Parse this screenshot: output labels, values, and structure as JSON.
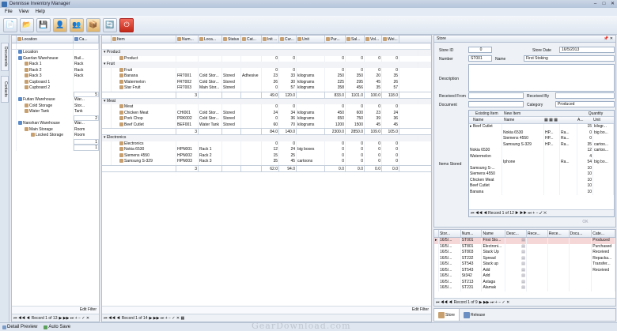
{
  "window": {
    "title": "Dennisse Inventory Manager",
    "minimize": "–",
    "maximize": "□",
    "close": "✕"
  },
  "menu": [
    "File",
    "View",
    "Help"
  ],
  "toolbar": {
    "icons": [
      "new-icon",
      "open-icon",
      "save-icon",
      "add-user-icon",
      "users-icon",
      "package-icon",
      "transfer-icon",
      "power-icon"
    ]
  },
  "sidetabs": {
    "documents": "Documents",
    "contacts": "Contacts"
  },
  "location_panel": {
    "headers": [
      "Location",
      "Ca..."
    ],
    "rows": [
      {
        "name": "Location",
        "cat": "",
        "level": 0
      },
      {
        "name": "Guerlan Warehouse",
        "cat": "Buil...",
        "level": 0
      },
      {
        "name": "Rack 1",
        "cat": "Rack",
        "level": 1
      },
      {
        "name": "Rack 2",
        "cat": "Rack",
        "level": 1
      },
      {
        "name": "Rack 3",
        "cat": "Rack",
        "level": 1
      },
      {
        "name": "Cupboard 1",
        "cat": "",
        "level": 1
      },
      {
        "name": "Cupboard 2",
        "cat": "",
        "level": 1
      },
      {
        "name": "",
        "cat": "5",
        "level": 1,
        "sum": true
      },
      {
        "name": "Futian Warehouse",
        "cat": "War...",
        "level": 0
      },
      {
        "name": "Cold Storage",
        "cat": "Stor...",
        "level": 1
      },
      {
        "name": "Water Tank",
        "cat": "Tank",
        "level": 1
      },
      {
        "name": "",
        "cat": "2",
        "level": 1,
        "sum": true
      },
      {
        "name": "Nanshan Warehouse",
        "cat": "War...",
        "level": 0
      },
      {
        "name": "Main Storage",
        "cat": "Room",
        "level": 1
      },
      {
        "name": "Locked Storage",
        "cat": "Room",
        "level": 2
      },
      {
        "name": "",
        "cat": "1",
        "level": 2,
        "sum": true
      },
      {
        "name": "",
        "cat": "1",
        "level": 1,
        "sum": true
      }
    ],
    "edit_filter": "Edit Filter",
    "pager": "Record 1 of 13"
  },
  "item_panel": {
    "headers": [
      "Item",
      "Num...",
      "Loca...",
      "Status",
      "Cat...",
      "Init ...",
      "Cur...",
      "Unit",
      "Pur...",
      "Sal...",
      "Vol...",
      "Wei..."
    ],
    "groups": [
      {
        "title": "Product",
        "items": [
          {
            "name": "Product",
            "num": "",
            "loc": "",
            "status": "",
            "cat": "",
            "init": "0",
            "cur": "0",
            "unit": "",
            "pur": "0",
            "sal": "0",
            "vol": "0",
            "wei": "0"
          }
        ]
      },
      {
        "title": "Fruit",
        "items": [
          {
            "name": "Fruit",
            "num": "",
            "loc": "",
            "status": "",
            "cat": "",
            "init": "0",
            "cur": "0",
            "unit": "",
            "pur": "0",
            "sal": "0",
            "vol": "0",
            "wei": "0"
          },
          {
            "name": "Banana",
            "num": "FRT001",
            "loc": "Cold Stor...",
            "status": "Stored",
            "cat": "Adhesive",
            "init": "23",
            "cur": "33",
            "unit": "kilograms",
            "pur": "250",
            "sal": "350",
            "vol": "20",
            "wei": "35"
          },
          {
            "name": "Watermelon",
            "num": "FRT002",
            "loc": "Cold Stor...",
            "status": "Stored",
            "cat": "",
            "init": "26",
            "cur": "30",
            "unit": "kilograms",
            "pur": "225",
            "sal": "295",
            "vol": "45",
            "wei": "26"
          },
          {
            "name": "Star Fruit",
            "num": "FRT003",
            "loc": "Main Stor...",
            "status": "Stored",
            "cat": "",
            "init": "0",
            "cur": "57",
            "unit": "kilograms",
            "pur": "358",
            "sal": "456",
            "vol": "35",
            "wei": "57"
          }
        ],
        "sum": {
          "num": "3",
          "init": "49.0",
          "cur": "120.0",
          "pur": "833.0",
          "sal": "1101.0",
          "vol": "100.0",
          "wei": "118.0"
        }
      },
      {
        "title": "Meat",
        "items": [
          {
            "name": "Meat",
            "num": "",
            "loc": "",
            "status": "",
            "cat": "",
            "init": "0",
            "cur": "0",
            "unit": "",
            "pur": "0",
            "sal": "0",
            "vol": "0",
            "wei": "0"
          },
          {
            "name": "Chicken Meat",
            "num": "CHI001",
            "loc": "Cold Stor...",
            "status": "Stored",
            "cat": "",
            "init": "24",
            "cur": "34",
            "unit": "kilograms",
            "pur": "450",
            "sal": "600",
            "vol": "23",
            "wei": "24"
          },
          {
            "name": "Pork Chop",
            "num": "PRK002",
            "loc": "Cold Stor...",
            "status": "Stored",
            "cat": "",
            "init": "0",
            "cur": "36",
            "unit": "kilograms",
            "pur": "650",
            "sal": "750",
            "vol": "39",
            "wei": "36"
          },
          {
            "name": "Beef Cutlet",
            "num": "BEF001",
            "loc": "Water Tank",
            "status": "Stored",
            "cat": "",
            "init": "60",
            "cur": "70",
            "unit": "kilograms",
            "pur": "1200",
            "sal": "1500",
            "vol": "45",
            "wei": "45"
          }
        ],
        "sum": {
          "num": "3",
          "init": "84.0",
          "cur": "140.0",
          "pur": "2300.0",
          "sal": "2850.0",
          "vol": "109.0",
          "wei": "105.0"
        }
      },
      {
        "title": "Electronics",
        "items": [
          {
            "name": "Electronics",
            "num": "",
            "loc": "",
            "status": "",
            "cat": "",
            "init": "0",
            "cur": "0",
            "unit": "",
            "pur": "0",
            "sal": "0",
            "vol": "0",
            "wei": "0"
          },
          {
            "name": "Nokia 6530",
            "num": "HPN001",
            "loc": "Rack 1",
            "status": "",
            "cat": "",
            "init": "12",
            "cur": "24",
            "unit": "big boxes",
            "pur": "0",
            "sal": "0",
            "vol": "0",
            "wei": "0"
          },
          {
            "name": "Siemens 4550",
            "num": "HPN002",
            "loc": "Rack 2",
            "status": "",
            "cat": "",
            "init": "15",
            "cur": "25",
            "unit": "",
            "pur": "0",
            "sal": "0",
            "vol": "0",
            "wei": "0"
          },
          {
            "name": "Samsung S-329",
            "num": "HPN003",
            "loc": "Rack 3",
            "status": "",
            "cat": "",
            "init": "35",
            "cur": "45",
            "unit": "cartoons",
            "pur": "0",
            "sal": "0",
            "vol": "0",
            "wei": "0"
          }
        ],
        "sum": {
          "num": "3",
          "init": "62.0",
          "cur": "94.0",
          "pur": "0.0",
          "sal": "0.0",
          "vol": "0.0",
          "wei": "0.0"
        }
      }
    ],
    "edit_filter": "Edit Filter",
    "pager": "Record 1 of 14"
  },
  "store_panel": {
    "title": "Store",
    "store_id_label": "Store ID",
    "store_id": "0",
    "store_date_label": "Store Date",
    "store_date": "16/5/2013",
    "number_label": "Number",
    "number": "ST001",
    "name_label": "Name",
    "name": "First Stoking",
    "description_label": "Description",
    "received_from_label": "Received From",
    "received_by_label": "Received By",
    "document_label": "Document",
    "category_label": "Category",
    "category": "Produced",
    "items_stored_label": "Items Stored",
    "sub_headers": {
      "existing": "Existing Item",
      "new": "New Item",
      "quantity": "Quantity"
    },
    "sub_cols": [
      "Name",
      "Name",
      "A...",
      "Unit"
    ],
    "sub_rows": [
      {
        "ex": "Beef Cutlet",
        "new": "",
        "a": "",
        "b": "",
        "q": "15",
        "u": "kilogr..."
      },
      {
        "ex": "",
        "new": "Nokia 6530",
        "a": "HP...",
        "b": "Ra...",
        "q": "0",
        "u": "big bo..."
      },
      {
        "ex": "",
        "new": "Siemens 4550",
        "a": "HP...",
        "b": "Ra...",
        "q": "0",
        "u": ""
      },
      {
        "ex": "",
        "new": "Samsung S-329",
        "a": "HP...",
        "b": "Ra...",
        "q": "35",
        "u": "cartoo..."
      },
      {
        "ex": "Nokia 6530",
        "new": "",
        "a": "",
        "b": "",
        "q": "12",
        "u": "cartoo..."
      },
      {
        "ex": "Watermelon",
        "new": "",
        "a": "",
        "b": "",
        "q": "4",
        "u": ""
      },
      {
        "ex": "",
        "new": "Iphone",
        "a": "",
        "b": "Ra...",
        "q": "54",
        "u": "big bo..."
      },
      {
        "ex": "Samsung S-...",
        "new": "",
        "a": "",
        "b": "",
        "q": "10",
        "u": ""
      },
      {
        "ex": "Siemens 4550",
        "new": "",
        "a": "",
        "b": "",
        "q": "10",
        "u": ""
      },
      {
        "ex": "Chicken Meat",
        "new": "",
        "a": "",
        "b": "",
        "q": "10",
        "u": ""
      },
      {
        "ex": "Beef Cutlet",
        "new": "",
        "a": "",
        "b": "",
        "q": "10",
        "u": ""
      },
      {
        "ex": "Banana",
        "new": "",
        "a": "",
        "b": "",
        "q": "10",
        "u": ""
      }
    ],
    "sub_pager": "Record 1 of 12",
    "ok": "OK"
  },
  "store_list": {
    "headers": [
      "Stor...",
      "Num...",
      "Name",
      "Desc...",
      "Rece...",
      "Rece...",
      "Docu...",
      "Cate..."
    ],
    "rows": [
      {
        "d": "16/5/...",
        "n": "ST001",
        "name": "First Sto...",
        "c": "Produced"
      },
      {
        "d": "16/5/...",
        "n": "ST801",
        "name": "Electroni...",
        "c": "Purchased"
      },
      {
        "d": "16/5/...",
        "n": "ST803",
        "name": "Stack Up",
        "c": "Received"
      },
      {
        "d": "16/5/...",
        "n": "ST232",
        "name": "Spread",
        "c": "Repacka..."
      },
      {
        "d": "16/5/...",
        "n": "ST543",
        "name": "Stack up",
        "c": "Transfer..."
      },
      {
        "d": "16/5/...",
        "n": "ST543",
        "name": "Add",
        "c": "Received"
      },
      {
        "d": "16/5/...",
        "n": "St342",
        "name": "Add",
        "c": ""
      },
      {
        "d": "16/5/...",
        "n": "ST213",
        "name": "Astaga",
        "c": ""
      },
      {
        "d": "16/5/...",
        "n": "ST231",
        "name": "Alamak",
        "c": ""
      }
    ],
    "pager": "Record 1 of 9"
  },
  "bottom_tabs": {
    "store": "Store",
    "release": "Release"
  },
  "statusbar": {
    "detail_preview": "Detail Preview",
    "auto_save": "Auto Save"
  },
  "watermark": "GearDownload.com",
  "colors": {
    "accent": "#3a6fb0",
    "header_bg": "#e3e9f2",
    "selected_row": "#f6d7d7"
  }
}
